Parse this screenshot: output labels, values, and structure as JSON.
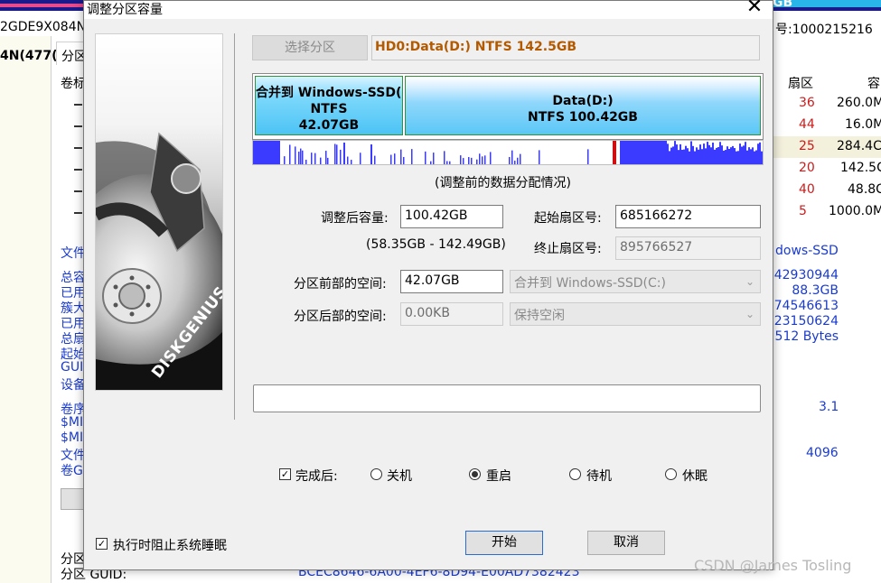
{
  "background_app": {
    "top_left_text": "2GDE9X084N",
    "left_text": "4N(477(",
    "top_right_text": "号:1000215216",
    "top_right_partial": "GB",
    "tab_label": "分区",
    "left_col_label": "卷标",
    "sector_header": "扇区",
    "capacity_header": "容",
    "sector_values": [
      "36",
      "44",
      "25",
      "20",
      "40",
      "5"
    ],
    "capacity_values": [
      "260.0M",
      "16.0M",
      "284.4C",
      "142.5C",
      "48.8C",
      "1000.0M"
    ],
    "left_labels": [
      "文件",
      "总容",
      "已用",
      "簇大",
      "已用",
      "总扇",
      "起始",
      "GUI",
      "设备",
      "卷序",
      "$MI",
      "$MI",
      "文件",
      "卷G"
    ],
    "right_fs_label": "dows-SSD",
    "right_values": [
      "42930944",
      "88.3GB",
      "74546613",
      "23150624",
      "512 Bytes"
    ],
    "right_values2": [
      "3.1",
      "4096"
    ],
    "bottom_label1": "分区",
    "bottom_label2": "分区 GUID:",
    "bottom_guid": "BCEC8646-6A00-4EF6-8D94-E00AD7382423"
  },
  "dialog": {
    "title": "调整分区容量",
    "close_glyph": "✕",
    "select_partition_button": "选择分区",
    "disk_info": "HD0:Data(D:) NTFS 142.5GB",
    "partition_map": {
      "seg1_line1": "合并到 Windows-SSD(C",
      "seg1_line2": "NTFS",
      "seg1_line3": "42.07GB",
      "seg2_line1": "Data(D:)",
      "seg2_line2": "NTFS 100.42GB"
    },
    "usage_caption": "(调整前的数据分配情况)",
    "resized_capacity_label": "调整后容量:",
    "resized_capacity_value": "100.42GB",
    "capacity_range": "(58.35GB - 142.49GB)",
    "start_sector_label": "起始扇区号:",
    "start_sector_value": "685166272",
    "end_sector_label": "终止扇区号:",
    "end_sector_value": "895766527",
    "space_before_label": "分区前部的空间:",
    "space_before_value": "42.07GB",
    "space_before_action": "合并到 Windows-SSD(C:)",
    "space_after_label": "分区后部的空间:",
    "space_after_value": "0.00KB",
    "space_after_action": "保持空闲",
    "progress_text": "",
    "after_completion_label": "完成后:",
    "options": [
      "关机",
      "重启",
      "待机",
      "休眠"
    ],
    "selected_option": "重启",
    "prevent_sleep_label": "执行时阻止系统睡眠",
    "start_button": "开始",
    "cancel_button": "取消",
    "image_brand": "DISKGENIUS"
  },
  "watermark": "CSDN @James Tosling",
  "colors": {
    "title_accent": "#1a1a8c",
    "disk_info_text": "#b35a00",
    "link_blue": "#1a3bcf",
    "sector_red": "#cc1b1b",
    "usage_blue": "#3b3bff",
    "usage_red": "#d01010"
  }
}
